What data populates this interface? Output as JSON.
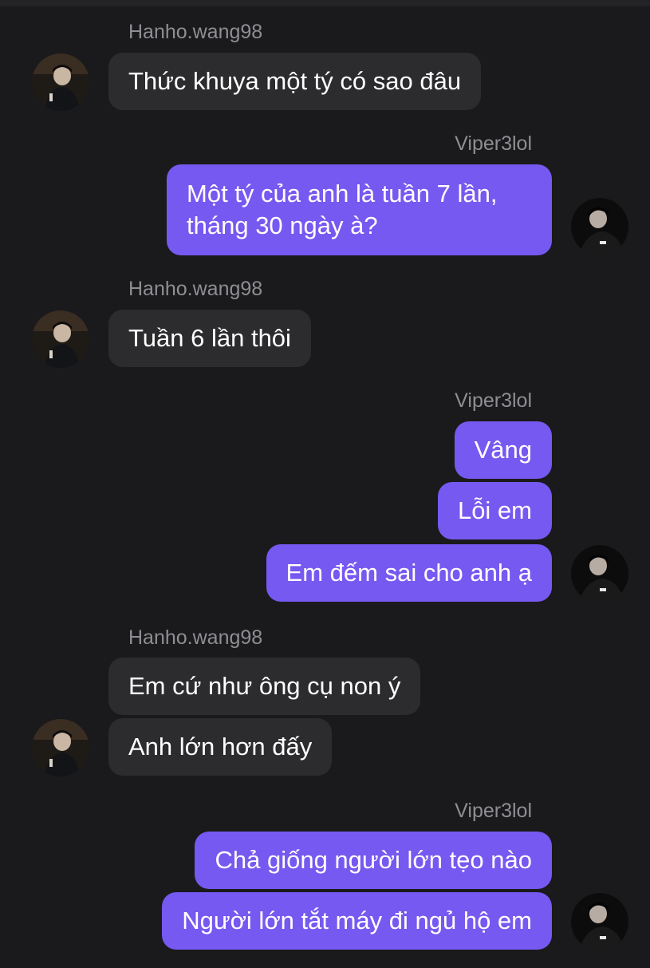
{
  "colors": {
    "background": "#1a1a1c",
    "incoming_bubble": "#2c2c2e",
    "outgoing_bubble": "#7659f0",
    "sender_name": "#8e8e93"
  },
  "users": {
    "left": "Hanho.wang98",
    "right": "Viper3lol"
  },
  "messages": {
    "m1": "Thức khuya một tý có sao đâu",
    "m2": "Một tý của anh là tuần 7 lần, tháng 30 ngày à?",
    "m3": "Tuần 6 lần thôi",
    "m4": "Vâng",
    "m5": "Lỗi em",
    "m6": "Em đếm sai cho anh ạ",
    "m7": "Em cứ như ông cụ non ý",
    "m8": "Anh lớn hơn đấy",
    "m9": "Chả giống người lớn tẹo nào",
    "m10": "Người lớn tắt máy đi ngủ hộ em"
  }
}
